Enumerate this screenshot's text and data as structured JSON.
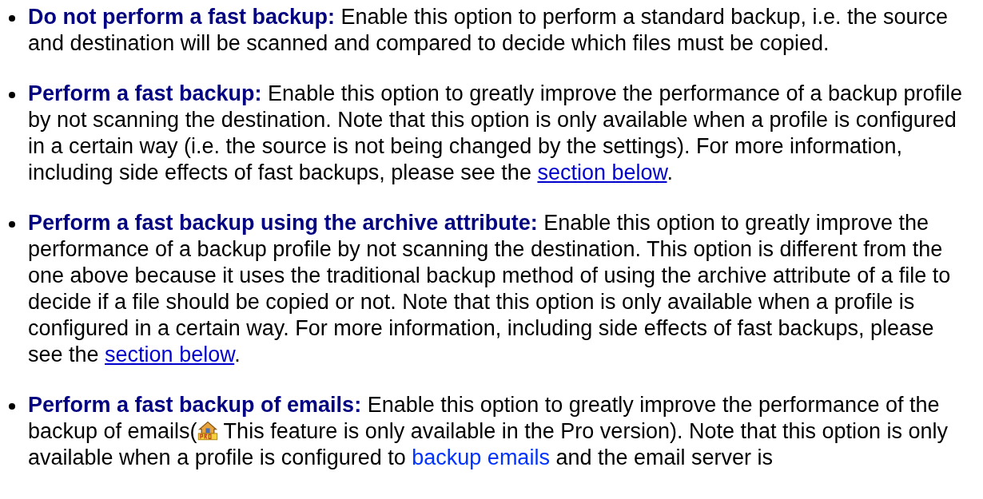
{
  "options": [
    {
      "title": "Do not perform a fast backup:",
      "parts": [
        {
          "kind": "text",
          "text": " Enable this option to perform a standard backup, i.e. the source and destination will be scanned and compared to decide which files must be copied."
        }
      ]
    },
    {
      "title": "Perform a fast backup:",
      "parts": [
        {
          "kind": "text",
          "text": " Enable this option to greatly improve the performance of a backup profile by not scanning the destination. Note that this option is only available when a profile is configured in a certain way (i.e. the source is not being changed by the settings). For more information, including side effects of fast backups, please see the "
        },
        {
          "kind": "link",
          "text": "section below",
          "underline": true
        },
        {
          "kind": "text",
          "text": "."
        }
      ]
    },
    {
      "title": "Perform a fast backup using the archive attribute:",
      "parts": [
        {
          "kind": "text",
          "text": " Enable this option to greatly improve the performance of a backup profile by not scanning the destination. This option is different from the one above because it uses the traditional backup method of using the archive attribute of a file to decide if a file should be copied or not. Note that this option is only available when a profile is configured in a certain way. For more information, including side effects of fast backups, please see the "
        },
        {
          "kind": "link",
          "text": "section below",
          "underline": true
        },
        {
          "kind": "text",
          "text": "."
        }
      ]
    },
    {
      "title": "Perform a fast backup of emails:",
      "parts": [
        {
          "kind": "text",
          "text": " Enable this option to greatly improve the performance of the backup of emails("
        },
        {
          "kind": "pro_icon"
        },
        {
          "kind": "text",
          "text": " This feature is only available in the Pro version). Note that this option is only available when a profile is configured to "
        },
        {
          "kind": "link",
          "text": "backup emails",
          "underline": false
        },
        {
          "kind": "text",
          "text": " and the email server is"
        }
      ]
    }
  ]
}
